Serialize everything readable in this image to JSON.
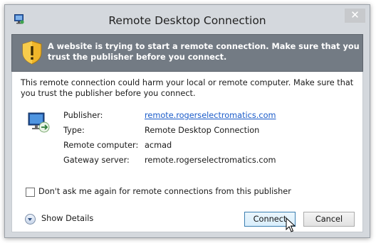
{
  "window": {
    "title": "Remote Desktop Connection",
    "close_label": "✕"
  },
  "banner": {
    "text": "A website is trying to start a remote connection. Make sure that you trust the publisher before you connect."
  },
  "content": {
    "message": "This remote connection could harm your local or remote computer. Make sure that you trust the publisher before you connect.",
    "details": [
      {
        "label": "Publisher:",
        "value": "remote.rogerselectromatics.com",
        "is_link": true
      },
      {
        "label": "Type:",
        "value": "Remote Desktop Connection",
        "is_link": false
      },
      {
        "label": "Remote computer:",
        "value": "acmad",
        "is_link": false
      },
      {
        "label": "Gateway server:",
        "value": "remote.rogerselectromatics.com",
        "is_link": false
      }
    ],
    "checkbox": {
      "label": "Don't ask me again for remote connections from this publisher",
      "checked": false
    },
    "show_details_label": "Show Details",
    "buttons": {
      "connect": "Connect",
      "cancel": "Cancel"
    }
  },
  "colors": {
    "banner_bg": "#737b84",
    "link": "#1a5bc9",
    "window_frame": "#d4d8dd"
  }
}
